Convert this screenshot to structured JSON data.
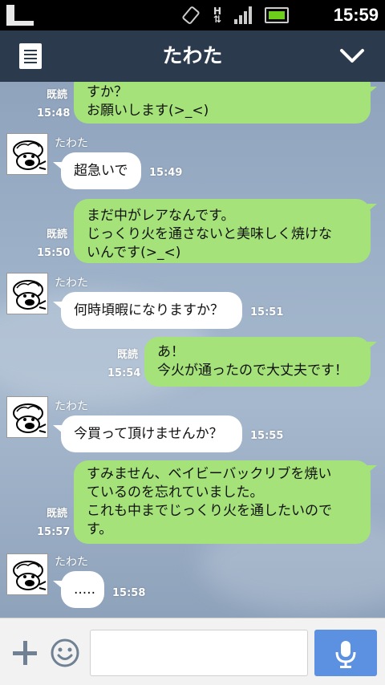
{
  "status_bar": {
    "time": "15:59",
    "network_label": "H"
  },
  "header": {
    "title": "たわた"
  },
  "messages": [
    {
      "dir": "out",
      "text": "すか？\nお願いします(>_<)",
      "read": "既読",
      "time": "15:48"
    },
    {
      "dir": "in",
      "sender": "たわた",
      "text": "超急いで",
      "time": "15:49"
    },
    {
      "dir": "out",
      "text": "まだ中がレアなんです。\nじっくり火を通さないと美味しく焼けな\nいんです(>_<)",
      "read": "既読",
      "time": "15:50"
    },
    {
      "dir": "in",
      "sender": "たわた",
      "text": "何時頃暇になりますか？",
      "time": "15:51"
    },
    {
      "dir": "out",
      "text": "あ！\n今火が通ったので大丈夫です！",
      "read": "既読",
      "time": "15:54"
    },
    {
      "dir": "in",
      "sender": "たわた",
      "text": "今買って頂けませんか？",
      "time": "15:55"
    },
    {
      "dir": "out",
      "text": "すみません、ベイビーバックリブを焼い\nているのを忘れていました。\nこれも中までじっくり火を通したいので\nす。",
      "read": "既読",
      "time": "15:57"
    },
    {
      "dir": "in",
      "sender": "たわた",
      "text": ".....",
      "time": "15:58"
    }
  ],
  "input": {
    "placeholder": "",
    "value": ""
  },
  "icons": {
    "menu": "note-icon",
    "collapse": "chevron-down-icon",
    "attach": "plus-icon",
    "emoji": "smiley-icon",
    "voice": "microphone-icon"
  },
  "colors": {
    "header_bg": "#2c3a4e",
    "outgoing_bubble": "#a5e37a",
    "incoming_bubble": "#ffffff",
    "mic_button": "#5c90e0"
  }
}
